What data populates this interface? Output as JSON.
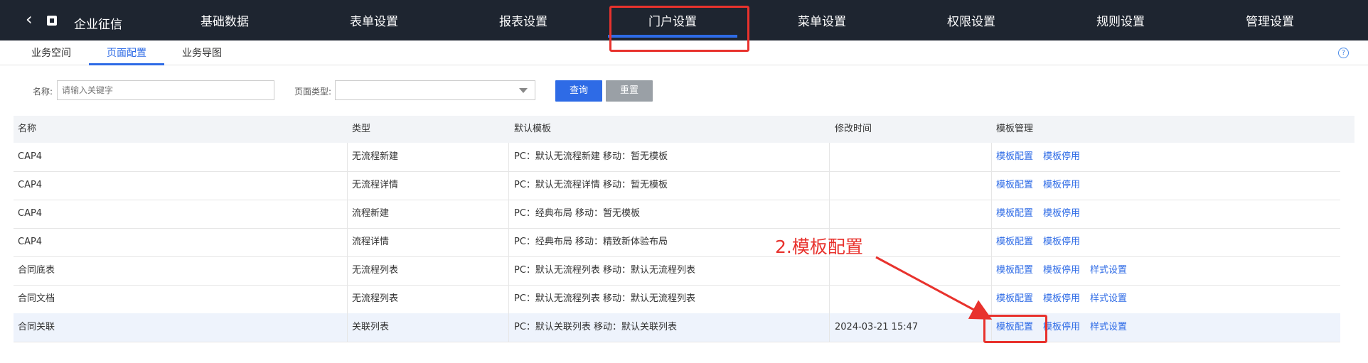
{
  "header": {
    "app_title": "企业征信",
    "tabs": [
      "基础数据",
      "表单设置",
      "报表设置",
      "门户设置",
      "菜单设置",
      "权限设置",
      "规则设置",
      "管理设置"
    ],
    "active_tab": "门户设置"
  },
  "subnav": {
    "tabs": [
      "业务空间",
      "页面配置",
      "业务导图"
    ],
    "active": "页面配置"
  },
  "filters": {
    "name_label": "名称:",
    "name_placeholder": "请输入关键字",
    "type_label": "页面类型:",
    "type_value": "",
    "query_label": "查询",
    "reset_label": "重置"
  },
  "table": {
    "columns": [
      "名称",
      "类型",
      "默认模板",
      "修改时间",
      "模板管理"
    ],
    "rows": [
      {
        "name": "CAP4",
        "type": "无流程新建",
        "template": "PC：默认无流程新建   移动：暂无模板",
        "time": "",
        "actions": [
          "模板配置",
          "模板停用"
        ]
      },
      {
        "name": "CAP4",
        "type": "无流程详情",
        "template": "PC：默认无流程详情   移动：暂无模板",
        "time": "",
        "actions": [
          "模板配置",
          "模板停用"
        ]
      },
      {
        "name": "CAP4",
        "type": "流程新建",
        "template": "PC：经典布局   移动：暂无模板",
        "time": "",
        "actions": [
          "模板配置",
          "模板停用"
        ]
      },
      {
        "name": "CAP4",
        "type": "流程详情",
        "template": "PC：经典布局   移动：精致新体验布局",
        "time": "",
        "actions": [
          "模板配置",
          "模板停用"
        ]
      },
      {
        "name": "合同底表",
        "type": "无流程列表",
        "template": "PC：默认无流程列表   移动：默认无流程列表",
        "time": "",
        "actions": [
          "模板配置",
          "模板停用",
          "样式设置"
        ]
      },
      {
        "name": "合同文档",
        "type": "无流程列表",
        "template": "PC：默认无流程列表   移动：默认无流程列表",
        "time": "",
        "actions": [
          "模板配置",
          "模板停用",
          "样式设置"
        ]
      },
      {
        "name": "合同关联",
        "type": "关联列表",
        "template": "PC：默认关联列表   移动：默认关联列表",
        "time": "2024-03-21 15:47",
        "actions": [
          "模板配置",
          "模板停用",
          "样式设置"
        ]
      }
    ]
  },
  "annotation": {
    "text": "2.模板配置",
    "color": "#e8322d"
  },
  "colors": {
    "accent": "#2e6be6",
    "topbar": "#1e2530",
    "highlight": "#e8322d"
  }
}
